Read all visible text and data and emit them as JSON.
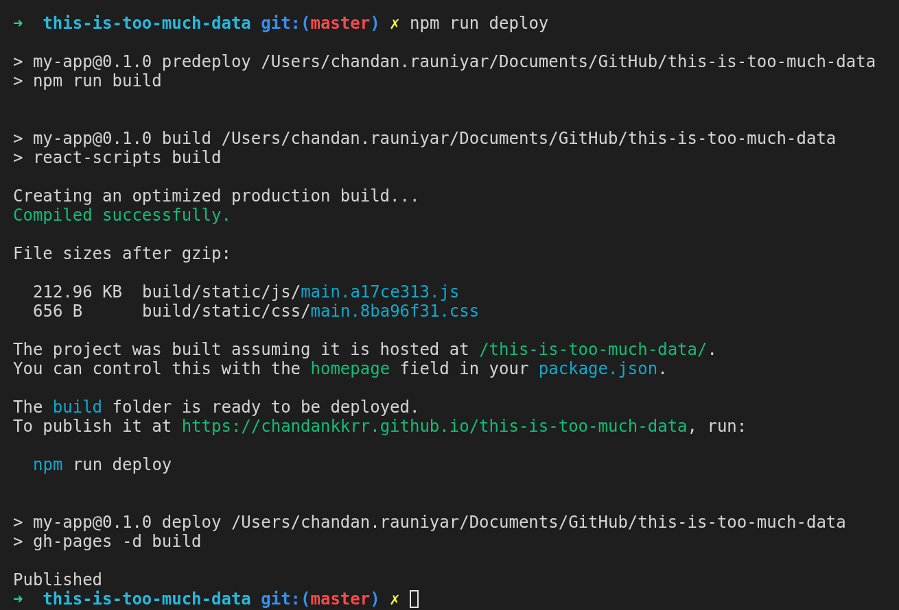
{
  "lines": [
    {
      "kind": "text",
      "segments": [
        {
          "kind": "arrow",
          "text": "➜"
        },
        {
          "kind": "dir",
          "text": "  this-is-too-much-data"
        },
        {
          "kind": "git",
          "text": " git:("
        },
        {
          "kind": "branch",
          "text": "master"
        },
        {
          "kind": "git",
          "text": ")"
        },
        {
          "kind": "dirty",
          "text": " ✗"
        },
        {
          "kind": "plain",
          "text": " npm run deploy"
        }
      ]
    },
    {
      "kind": "blank"
    },
    {
      "kind": "text",
      "segments": [
        {
          "kind": "plain",
          "text": "> my-app@0.1.0 predeploy /Users/chandan.rauniyar/Documents/GitHub/this-is-too-much-data"
        }
      ]
    },
    {
      "kind": "text",
      "segments": [
        {
          "kind": "plain",
          "text": "> npm run build"
        }
      ]
    },
    {
      "kind": "blank"
    },
    {
      "kind": "blank"
    },
    {
      "kind": "text",
      "segments": [
        {
          "kind": "plain",
          "text": "> my-app@0.1.0 build /Users/chandan.rauniyar/Documents/GitHub/this-is-too-much-data"
        }
      ]
    },
    {
      "kind": "text",
      "segments": [
        {
          "kind": "plain",
          "text": "> react-scripts build"
        }
      ]
    },
    {
      "kind": "blank"
    },
    {
      "kind": "text",
      "segments": [
        {
          "kind": "plain",
          "text": "Creating an optimized production build..."
        }
      ]
    },
    {
      "kind": "text",
      "segments": [
        {
          "kind": "success",
          "text": "Compiled successfully."
        }
      ]
    },
    {
      "kind": "blank"
    },
    {
      "kind": "text",
      "segments": [
        {
          "kind": "plain",
          "text": "File sizes after gzip:"
        }
      ]
    },
    {
      "kind": "blank"
    },
    {
      "kind": "indented",
      "segments": [
        {
          "kind": "plain",
          "text": "212.96 KB  build/static/js/"
        },
        {
          "kind": "link",
          "text": "main.a17ce313.js"
        }
      ]
    },
    {
      "kind": "indented",
      "segments": [
        {
          "kind": "plain",
          "text": "656 B      build/static/css/"
        },
        {
          "kind": "link",
          "text": "main.8ba96f31.css"
        }
      ]
    },
    {
      "kind": "blank"
    },
    {
      "kind": "text",
      "segments": [
        {
          "kind": "plain",
          "text": "The project was built assuming it is hosted at "
        },
        {
          "kind": "success",
          "text": "/this-is-too-much-data/"
        },
        {
          "kind": "plain",
          "text": "."
        }
      ]
    },
    {
      "kind": "text",
      "segments": [
        {
          "kind": "plain",
          "text": "You can control this with the "
        },
        {
          "kind": "success",
          "text": "homepage"
        },
        {
          "kind": "plain",
          "text": " field in your "
        },
        {
          "kind": "link",
          "text": "package.json"
        },
        {
          "kind": "plain",
          "text": "."
        }
      ]
    },
    {
      "kind": "blank"
    },
    {
      "kind": "text",
      "segments": [
        {
          "kind": "plain",
          "text": "The "
        },
        {
          "kind": "link",
          "text": "build"
        },
        {
          "kind": "plain",
          "text": " folder is ready to be deployed."
        }
      ]
    },
    {
      "kind": "text",
      "segments": [
        {
          "kind": "plain",
          "text": "To publish it at "
        },
        {
          "kind": "success",
          "text": "https://chandankkrr.github.io/this-is-too-much-data"
        },
        {
          "kind": "plain",
          "text": ", run:"
        }
      ]
    },
    {
      "kind": "blank"
    },
    {
      "kind": "indented",
      "segments": [
        {
          "kind": "link",
          "text": "npm"
        },
        {
          "kind": "plain",
          "text": " run deploy"
        }
      ]
    },
    {
      "kind": "blank"
    },
    {
      "kind": "blank"
    },
    {
      "kind": "text",
      "segments": [
        {
          "kind": "plain",
          "text": "> my-app@0.1.0 deploy /Users/chandan.rauniyar/Documents/GitHub/this-is-too-much-data"
        }
      ]
    },
    {
      "kind": "text",
      "segments": [
        {
          "kind": "plain",
          "text": "> gh-pages -d build"
        }
      ]
    },
    {
      "kind": "blank"
    },
    {
      "kind": "text",
      "segments": [
        {
          "kind": "plain",
          "text": "Published"
        }
      ]
    },
    {
      "kind": "prompt",
      "segments": [
        {
          "kind": "arrow",
          "text": "➜"
        },
        {
          "kind": "dir",
          "text": "  this-is-too-much-data"
        },
        {
          "kind": "git",
          "text": " git:("
        },
        {
          "kind": "branch",
          "text": "master"
        },
        {
          "kind": "git",
          "text": ")"
        },
        {
          "kind": "dirty",
          "text": " ✗"
        }
      ]
    }
  ]
}
